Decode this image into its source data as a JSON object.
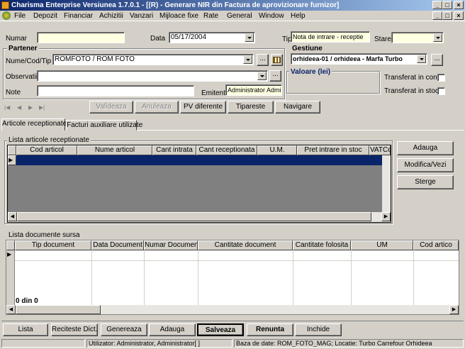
{
  "window": {
    "title": "Charisma Enterprise Versiunea 1.7.0.1 - [(R) - Generare NIR din Factura de aprovizionare furnizor]"
  },
  "menu": [
    "File",
    "Depozit",
    "Financiar",
    "Achizitii",
    "Vanzari",
    "Mijloace fixe",
    "Rate",
    "General",
    "Window",
    "Help"
  ],
  "form": {
    "numar_label": "Numar",
    "numar_value": "",
    "data_label": "Data",
    "data_value": "05/17/2004",
    "tip_label": "Tip",
    "tip_value": "Nota de intrare - receptie",
    "stare_label": "Stare",
    "stare_value": "",
    "partener_title": "Partener",
    "nume_label": "Nume/Cod/Tip",
    "nume_value": "ROMFOTO / ROM FOTO",
    "observatii_label": "Observatii",
    "observatii_value": "",
    "note_label": "Note",
    "note_value": "",
    "emitent_label": "Emitent",
    "emitent_value": "Administrator Admini",
    "gestiune_title": "Gestiune",
    "gestiune_value": "orhideea-01 / orhideea - Marfa Turbo",
    "valoare_title": "Valoare (lei)",
    "transf_cont_label": "Transferat in cont.",
    "transf_stoc_label": "Transferat in stoc",
    "ellipsis": "..."
  },
  "actions": {
    "valideaza": "Valideaza",
    "anuleaza": "Anuleaza",
    "pv": "PV diferente",
    "tipareste": "Tipareste",
    "navigare": "Navigare"
  },
  "nav": {
    "first": "|◀",
    "prev": "◀",
    "next": "▶",
    "last": "▶|"
  },
  "tabs": [
    "Articole receptionate",
    "Facturi auxiliare utilizate"
  ],
  "articole": {
    "title": "Lista articole receptionate",
    "columns": [
      "Cod articol",
      "Nume articol",
      "Cant intrata",
      "Cant receptionata",
      "U.M.",
      "Pret intrare in stoc",
      "VATCode"
    ],
    "buttons": {
      "adauga": "Adauga",
      "modifica": "Modifica/Vezi",
      "sterge": "Sterge"
    }
  },
  "documente": {
    "title": "Lista documente sursa",
    "columns": [
      "Tip document",
      "Data Document",
      "Numar Document",
      "Cantitate document",
      "Cantitate folosita",
      "UM",
      "Cod artico"
    ],
    "counter": "0 din 0"
  },
  "bottom": {
    "lista": "Lista",
    "reciteste": "Reciteste Dict.",
    "genereaza": "Genereaza",
    "adauga": "Adauga",
    "salveaza": "Salveaza",
    "renunta": "Renunta",
    "inchide": "Inchide"
  },
  "status": {
    "left": "",
    "user": "Utilizator: Administrator, Administrator[ ]",
    "db": "Baza de date: ROM_FOTO_MAG; Locatie: Turbo Carrefour Orhideea"
  }
}
